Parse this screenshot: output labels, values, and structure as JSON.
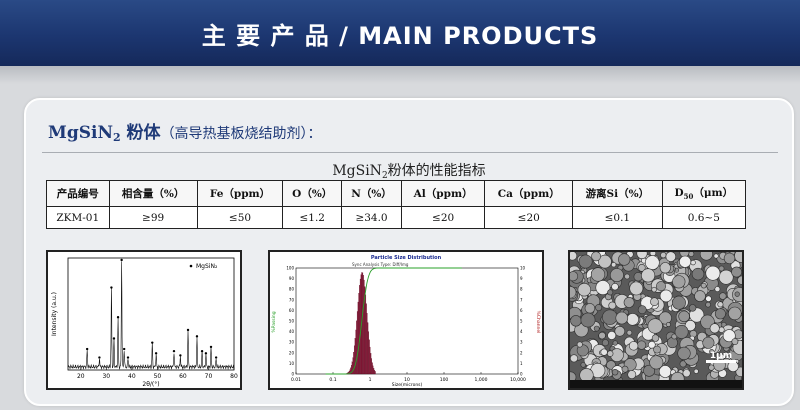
{
  "banner": {
    "title": "主 要 产 品 / MAIN PRODUCTS"
  },
  "product": {
    "name_main": "MgSiN",
    "name_sub": "2",
    "name_suffix": " 粉体",
    "description": "（高导热基板烧结助剂）：",
    "table_title_main": "MgSiN",
    "table_title_sub": "2",
    "table_title_suffix": "粉体的性能指标"
  },
  "table": {
    "headers": [
      "产品编号",
      "相含量（%）",
      "Fe（ppm）",
      "O（%）",
      "N（%）",
      "Al（ppm）",
      "Ca（ppm）",
      "游离Si（%）",
      "D50（μm）"
    ],
    "d50_prefix": "D",
    "d50_sub": "50",
    "d50_suffix": "（μm）",
    "row": [
      "ZKM-01",
      "≥99",
      "≤50",
      "≤1.2",
      "≥34.0",
      "≤20",
      "≤20",
      "≤0.1",
      "0.6~5"
    ]
  },
  "xrd": {
    "legend": "MgSiN₂",
    "ylabel": "Intensity (a.u.)",
    "xlabel": "2θ/(°)",
    "xticks": [
      "20",
      "30",
      "40",
      "50",
      "60",
      "70",
      "80"
    ],
    "xlim": [
      15,
      80
    ],
    "peaks": [
      [
        22.5,
        0.16
      ],
      [
        27.3,
        0.08
      ],
      [
        32.0,
        0.74
      ],
      [
        33.0,
        0.26
      ],
      [
        34.6,
        0.46
      ],
      [
        36.0,
        1.0
      ],
      [
        37.0,
        0.16
      ],
      [
        38.5,
        0.08
      ],
      [
        48.0,
        0.22
      ],
      [
        49.5,
        0.12
      ],
      [
        56.5,
        0.14
      ],
      [
        59.0,
        0.1
      ],
      [
        62.0,
        0.34
      ],
      [
        65.5,
        0.28
      ],
      [
        67.5,
        0.14
      ],
      [
        69.0,
        0.12
      ],
      [
        71.0,
        0.18
      ],
      [
        73.0,
        0.08
      ]
    ]
  },
  "psd": {
    "title": "Particle Size Distribution",
    "subtitle": "Sync Analysis Type: Diff/Img",
    "ylabel_left": "%Passing",
    "ylabel_right": "%Channel",
    "xlabel": "Size(microns)",
    "xticks": [
      "0.01",
      "0.1",
      "1",
      "10",
      "100",
      "1,000",
      "10,000"
    ],
    "yticks_left": [
      "0",
      "10",
      "20",
      "30",
      "40",
      "50",
      "60",
      "70",
      "80",
      "90",
      "100"
    ],
    "yticks_right": [
      "0",
      "1",
      "2",
      "3",
      "4",
      "5",
      "6",
      "7",
      "8",
      "9",
      "10"
    ]
  },
  "sem": {
    "scale_label": "1μm"
  },
  "colors": {
    "banner": "#1c3670",
    "heading": "#1f3a78",
    "psd_curve": "#2aa02a",
    "psd_bars": "#8b1a3a"
  }
}
